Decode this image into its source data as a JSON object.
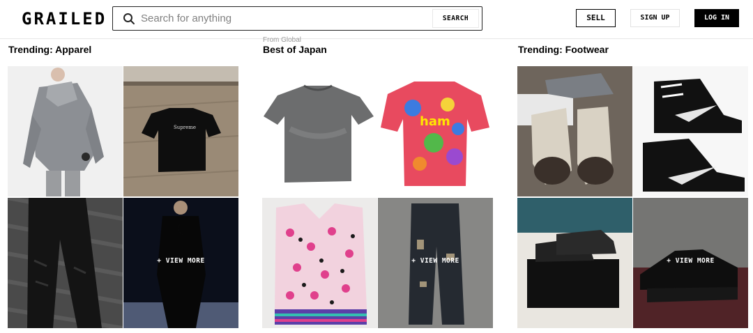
{
  "header": {
    "logo": "GRAILED",
    "search": {
      "placeholder": "Search for anything",
      "button_label": "SEARCH"
    },
    "sell_label": "SELL",
    "signup_label": "SIGN UP",
    "login_label": "LOG IN"
  },
  "sections": [
    {
      "kicker": "",
      "title": "Trending: Apparel",
      "view_more": "+ VIEW MORE"
    },
    {
      "kicker": "From Global",
      "title": "Best of Japan",
      "view_more": "+ VIEW MORE"
    },
    {
      "kicker": "",
      "title": "Trending: Footwear",
      "view_more": "+ VIEW MORE"
    }
  ],
  "colors": {
    "text": "#000000",
    "login_bg": "#000000",
    "border": "#222222"
  }
}
